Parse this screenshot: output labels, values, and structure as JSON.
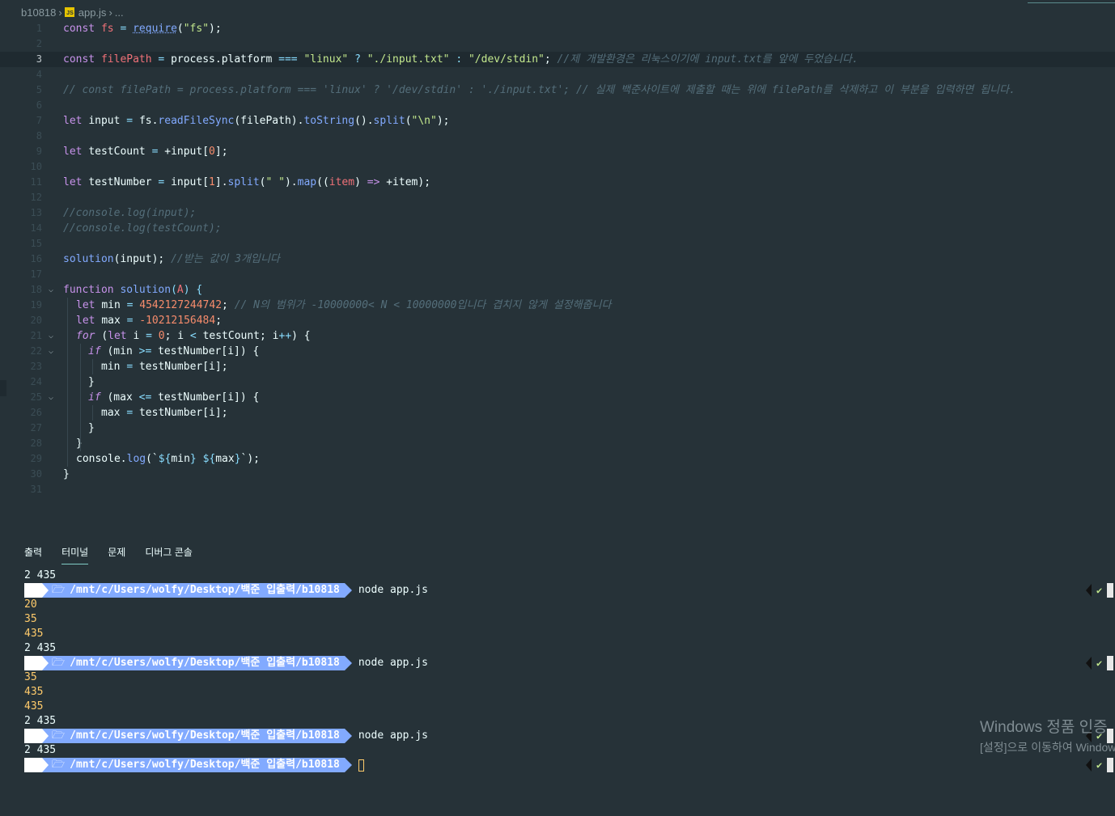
{
  "breadcrumb": {
    "folder": "b10818",
    "file": "app.js",
    "more": "...",
    "file_icon_text": "JS"
  },
  "editor": {
    "lines": [
      {
        "n": "1"
      },
      {
        "n": "2"
      },
      {
        "n": "3"
      },
      {
        "n": "4"
      },
      {
        "n": "5"
      },
      {
        "n": "6"
      },
      {
        "n": "7"
      },
      {
        "n": "8"
      },
      {
        "n": "9"
      },
      {
        "n": "10"
      },
      {
        "n": "11"
      },
      {
        "n": "12"
      },
      {
        "n": "13"
      },
      {
        "n": "14"
      },
      {
        "n": "15"
      },
      {
        "n": "16"
      },
      {
        "n": "17"
      },
      {
        "n": "18"
      },
      {
        "n": "19"
      },
      {
        "n": "20"
      },
      {
        "n": "21"
      },
      {
        "n": "22"
      },
      {
        "n": "23"
      },
      {
        "n": "24"
      },
      {
        "n": "25"
      },
      {
        "n": "26"
      },
      {
        "n": "27"
      },
      {
        "n": "28"
      },
      {
        "n": "29"
      },
      {
        "n": "30"
      },
      {
        "n": "31"
      }
    ],
    "code": {
      "l1": [
        "const",
        "fs",
        "=",
        "require",
        "(",
        "\"fs\"",
        ");"
      ],
      "l3": [
        "const",
        "filePath",
        "=",
        "process.platform",
        "===",
        "\"linux\"",
        "?",
        "\"./input.txt\"",
        ":",
        "\"/dev/stdin\"",
        ";",
        "//제 개발환경은 리눅스이기에 input.txt를 앞에 두었습니다."
      ],
      "l5": "// const filePath = process.platform === 'linux' ? '/dev/stdin' : './input.txt'; // 실제 백준사이트에 제출할 때는 위에 filePath를 삭제하고 이 부분을 입력하면 됩니다.",
      "l7": [
        "let",
        "input",
        "=",
        "fs.",
        "readFileSync",
        "(filePath).",
        "toString",
        "().",
        "split",
        "(",
        "\"\\n\"",
        ");"
      ],
      "l9": [
        "let",
        "testCount",
        "=",
        "+input[",
        "0",
        "];"
      ],
      "l11": [
        "let",
        "testNumber",
        "=",
        "input[",
        "1",
        "].",
        "split",
        "(",
        "\" \"",
        ").",
        "map",
        "((",
        "item",
        ")",
        "=>",
        "+item);"
      ],
      "l13": "//console.log(input);",
      "l14": "//console.log(testCount);",
      "l16": [
        "solution",
        "(input);",
        "//받는 값이 3개입니다"
      ],
      "l18": [
        "function",
        "solution",
        "(",
        "A",
        ") {"
      ],
      "l19": [
        "let",
        "min",
        "=",
        "4542127244742",
        ";",
        "// N의 범위가 -10000000< N < 10000000입니다 겹치지 않게 설정해줍니다"
      ],
      "l20": [
        "let",
        "max",
        "=",
        "-10212156484",
        ";"
      ],
      "l21": [
        "for",
        "(",
        "let",
        "i",
        "=",
        "0",
        ";",
        "i",
        "<",
        "testCount;",
        "i",
        "++",
        ") {"
      ],
      "l22": [
        "if",
        "(min",
        ">=",
        "testNumber[i]) {"
      ],
      "l23": [
        "min",
        "=",
        "testNumber[i];"
      ],
      "l24": "}",
      "l25": [
        "if",
        "(max",
        "<=",
        "testNumber[i]) {"
      ],
      "l26": [
        "max",
        "=",
        "testNumber[i];"
      ],
      "l27": "}",
      "l28": "}",
      "l29": [
        "console.",
        "log",
        "(`",
        "${",
        "min",
        "}",
        " ",
        "${",
        "max",
        "}",
        "`);"
      ],
      "l30": "}"
    }
  },
  "panel": {
    "tabs": [
      {
        "label": "출력"
      },
      {
        "label": "터미널"
      },
      {
        "label": "문제"
      },
      {
        "label": "디버그 콘솔"
      }
    ]
  },
  "terminal": {
    "prompt_icon": "",
    "folder_icon": "🗁",
    "path": "/mnt/c/Users/wolfy/Desktop/백준 입출력/b10818",
    "command": "node app.js",
    "check": "✔",
    "out": {
      "a": "2 435",
      "b": "20",
      "c": "35",
      "d": "435",
      "e": "2 435",
      "f": "35",
      "g": "435",
      "h": "435",
      "i": "2 435",
      "j": "2 435"
    }
  },
  "watermark": {
    "line1": "Windows 정품 인증",
    "line2": "[설정]으로 이동하여 Windows"
  },
  "colors": {
    "background": "#263238",
    "keyword": "#c792ea",
    "function": "#82aaff",
    "string": "#c3e88d",
    "number": "#f78c6c",
    "prompt": "#82aaff",
    "output_yellow": "#ffcb6b"
  }
}
